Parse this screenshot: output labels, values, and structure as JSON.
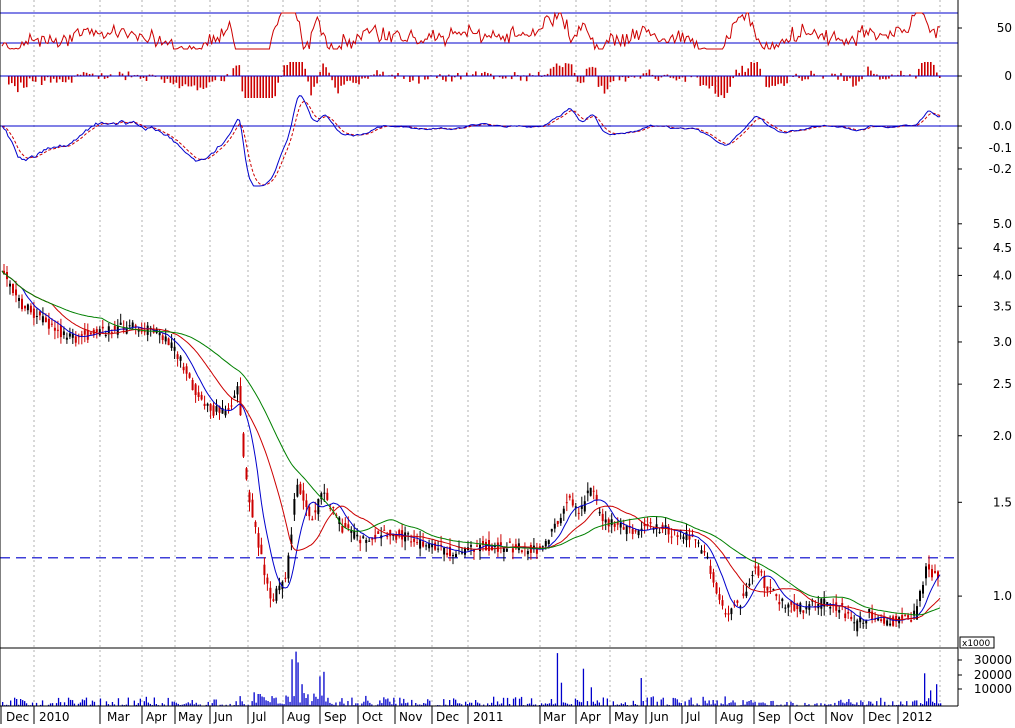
{
  "chart_data": {
    "type": "candlestick",
    "x_axis": {
      "month_labels": [
        "Dec",
        "2010",
        "Mar",
        "Apr",
        "May",
        "Jun",
        "Jul",
        "Aug",
        "Sep",
        "Oct",
        "Nov",
        "Dec",
        "2011",
        "Mar",
        "Apr",
        "May",
        "Jun",
        "Jul",
        "Aug",
        "Sep",
        "Oct",
        "Nov",
        "Dec",
        "2012"
      ]
    },
    "panels": {
      "rsi": {
        "type": "line",
        "ticks": [
          "50"
        ],
        "levels": [
          70,
          30
        ],
        "ylim": [
          0,
          100
        ],
        "color": "#cc0000"
      },
      "momentum_bars": {
        "type": "bar",
        "ticks": [
          "0"
        ],
        "ylim": [
          -1,
          1
        ],
        "color": "#cc0000"
      },
      "macd": {
        "type": "line",
        "ticks": [
          "0.0",
          "-0.1",
          "-0.2"
        ],
        "ylim": [
          -0.28,
          0.05
        ],
        "colors": {
          "macd": "#0000cc",
          "signal": "#cc0000"
        }
      },
      "price": {
        "type": "candlestick",
        "scale": "log",
        "ticks": [
          "5.0",
          "4.5",
          "4.0",
          "3.5",
          "3.0",
          "2.5",
          "2.0",
          "1.5",
          "1.0"
        ],
        "ylim": [
          0.82,
          5.4
        ],
        "reference_line": 1.18,
        "moving_averages": [
          {
            "color": "#0000cc"
          },
          {
            "color": "#cc0000"
          },
          {
            "color": "#008000"
          }
        ],
        "anchor_closes": [
          [
            0,
            4.05
          ],
          [
            18,
            3.55
          ],
          [
            40,
            3.3
          ],
          [
            70,
            3.05
          ],
          [
            100,
            3.15
          ],
          [
            130,
            3.2
          ],
          [
            160,
            3.1
          ],
          [
            175,
            2.85
          ],
          [
            190,
            2.5
          ],
          [
            205,
            2.25
          ],
          [
            225,
            2.2
          ],
          [
            237,
            2.45
          ],
          [
            243,
            1.7
          ],
          [
            255,
            1.3
          ],
          [
            270,
            0.98
          ],
          [
            285,
            1.1
          ],
          [
            295,
            1.62
          ],
          [
            310,
            1.4
          ],
          [
            322,
            1.55
          ],
          [
            340,
            1.35
          ],
          [
            360,
            1.28
          ],
          [
            380,
            1.32
          ],
          [
            400,
            1.3
          ],
          [
            420,
            1.25
          ],
          [
            440,
            1.22
          ],
          [
            460,
            1.21
          ],
          [
            480,
            1.25
          ],
          [
            500,
            1.24
          ],
          [
            520,
            1.23
          ],
          [
            540,
            1.22
          ],
          [
            555,
            1.35
          ],
          [
            568,
            1.55
          ],
          [
            578,
            1.42
          ],
          [
            590,
            1.6
          ],
          [
            600,
            1.4
          ],
          [
            615,
            1.35
          ],
          [
            630,
            1.32
          ],
          [
            650,
            1.35
          ],
          [
            670,
            1.32
          ],
          [
            690,
            1.28
          ],
          [
            705,
            1.2
          ],
          [
            715,
            1.05
          ],
          [
            725,
            0.92
          ],
          [
            740,
            0.98
          ],
          [
            755,
            1.15
          ],
          [
            765,
            1.05
          ],
          [
            780,
            0.98
          ],
          [
            800,
            0.95
          ],
          [
            820,
            0.97
          ],
          [
            840,
            0.95
          ],
          [
            855,
            0.88
          ],
          [
            870,
            0.93
          ],
          [
            885,
            0.9
          ],
          [
            900,
            0.9
          ],
          [
            915,
            0.92
          ],
          [
            928,
            1.15
          ],
          [
            935,
            1.08
          ],
          [
            940,
            1.12
          ]
        ]
      },
      "volume": {
        "type": "bar",
        "ticks": [
          "30000",
          "20000",
          "10000"
        ],
        "unit_label": "x1000",
        "ylim": [
          0,
          36000
        ],
        "color": "#0000cc"
      }
    }
  }
}
